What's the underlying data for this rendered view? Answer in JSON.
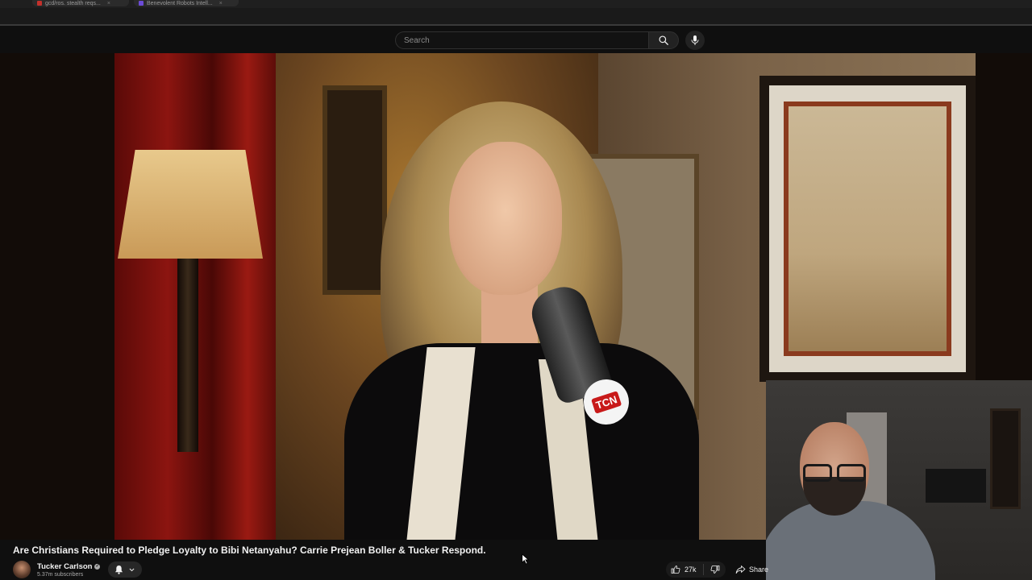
{
  "browser": {
    "tabs": [
      {
        "label": "gcd/ros. stealth reqs...",
        "favicon_color": "#c4302b"
      },
      {
        "label": "Benevolent Robots Intell...",
        "favicon_color": "#6b4bd6"
      }
    ]
  },
  "search": {
    "placeholder": "Search"
  },
  "video": {
    "title": "Are Christians Required to Pledge Loyalty to Bibi Netanyahu? Carrie Prejean Boller & Tucker Respond.",
    "mic_logo": "TCN"
  },
  "channel": {
    "name": "Tucker Carlson",
    "subscribers": "5.37m subscribers"
  },
  "actions": {
    "like_count": "27k",
    "share_label": "Share"
  },
  "icons": {
    "search": "search-icon",
    "mic": "microphone-icon",
    "bell": "bell-icon",
    "chevron": "chevron-down-icon",
    "like": "thumbs-up-icon",
    "dislike": "thumbs-down-icon",
    "share": "share-icon"
  },
  "colors": {
    "background": "#0f0f0f",
    "text": "#f1f1f1",
    "secondary_text": "#aaaaaa",
    "tcn_red": "#c81a1a"
  }
}
